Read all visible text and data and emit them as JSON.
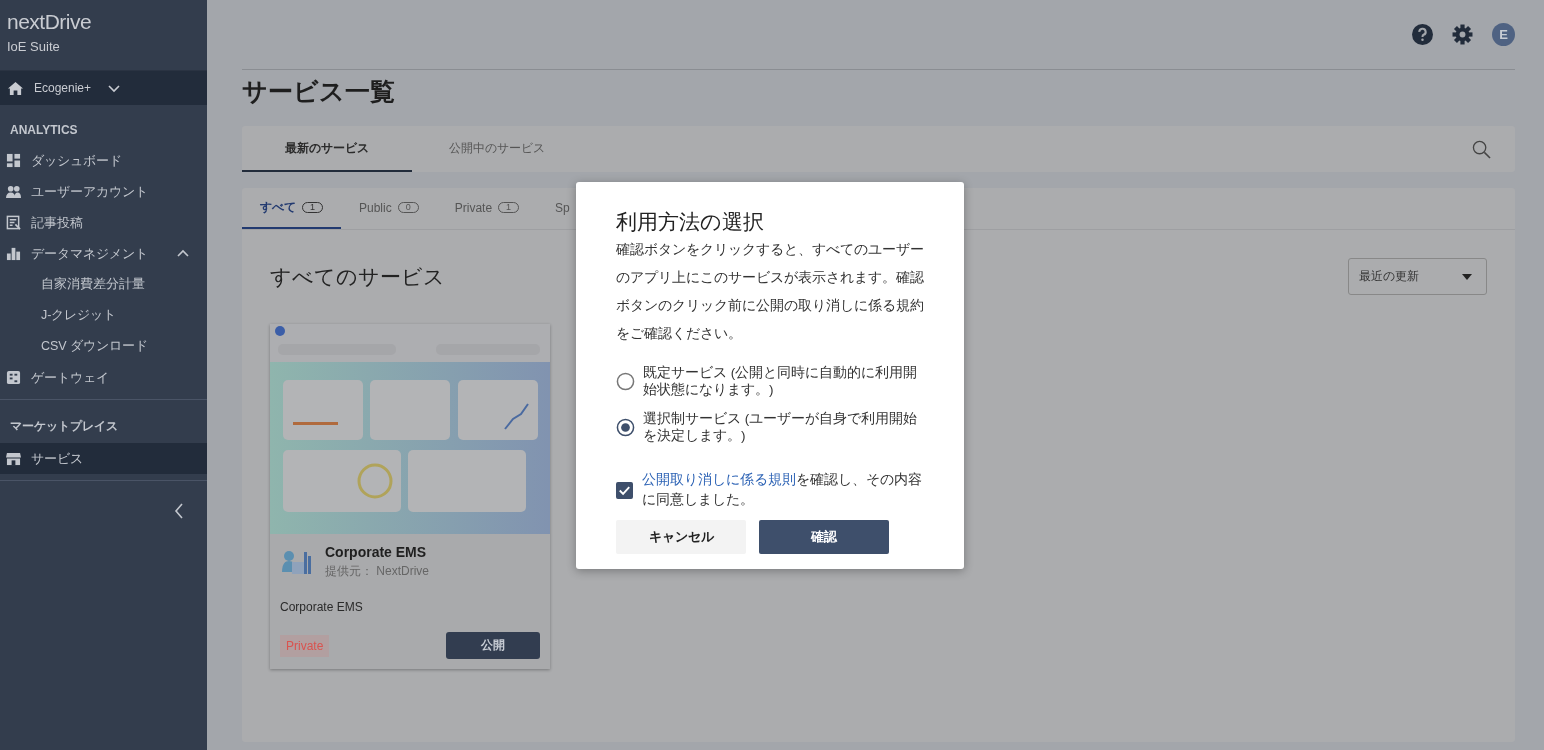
{
  "sidebar": {
    "brand": "nextDrive",
    "subtitle": "IoE Suite",
    "workspace": {
      "label": "Ecogenie+"
    },
    "sections": [
      {
        "title": "ANALYTICS",
        "items": [
          {
            "label": "ダッシュボード",
            "selected": false
          },
          {
            "label": "ユーザーアカウント",
            "selected": false
          },
          {
            "label": "記事投稿",
            "selected": false
          },
          {
            "label": "データマネジメント",
            "selected": false,
            "expanded": true,
            "children": [
              {
                "label": "自家消費差分計量",
                "selected": false
              },
              {
                "label": "J-クレジット",
                "selected": false
              },
              {
                "label": "CSV ダウンロード",
                "selected": false
              }
            ]
          },
          {
            "label": "ゲートウェイ",
            "selected": false
          }
        ]
      },
      {
        "title": "マーケットプレイス",
        "items": [
          {
            "label": "サービス",
            "selected": true
          }
        ]
      }
    ]
  },
  "header": {
    "avatar": "E"
  },
  "page_title": "サービス一覧",
  "main_tabs": [
    {
      "label": "最新のサービス",
      "selected": true
    },
    {
      "label": "公開中のサービス",
      "selected": false
    }
  ],
  "filter_tabs": [
    {
      "label": "すべて",
      "count": "1",
      "selected": true
    },
    {
      "label": "Public",
      "count": "0",
      "selected": false
    },
    {
      "label": "Private",
      "count": "1",
      "selected": false
    },
    {
      "label": "Sp",
      "selected": false
    }
  ],
  "section_title": "すべてのサービス",
  "sort": {
    "value": "最近の更新"
  },
  "services": [
    {
      "kind": "picture",
      "name": "Corporate EMS",
      "provider": "提供元： NextDrive",
      "description": "Corporate EMS",
      "tag": {
        "label": "Private",
        "color": "#d9534f"
      },
      "action": "公開"
    }
  ],
  "dialog": {
    "title": "利用方法の選択",
    "message": "確認ボタンをクリックすると、すべてのユーザーのアプリ上にこのサービスが表示されます。確認ボタンのクリック前に公開の取り消しに係る規約をご確認ください。",
    "options": [
      {
        "label": "既定サービス (公開と同時に自動的に利用開始状態になります。)",
        "selected": false
      },
      {
        "label": "選択制サービス (ユーザーが自身で利用開始を決定します。)",
        "selected": true
      }
    ],
    "agreement": {
      "link": "公開取り消しに係る規則",
      "text": "を確認し、その内容に同意しました。",
      "checked": true
    },
    "buttons": [
      {
        "label": "キャンセル",
        "kind": "secondary"
      },
      {
        "label": "確認",
        "kind": "primary"
      }
    ]
  }
}
